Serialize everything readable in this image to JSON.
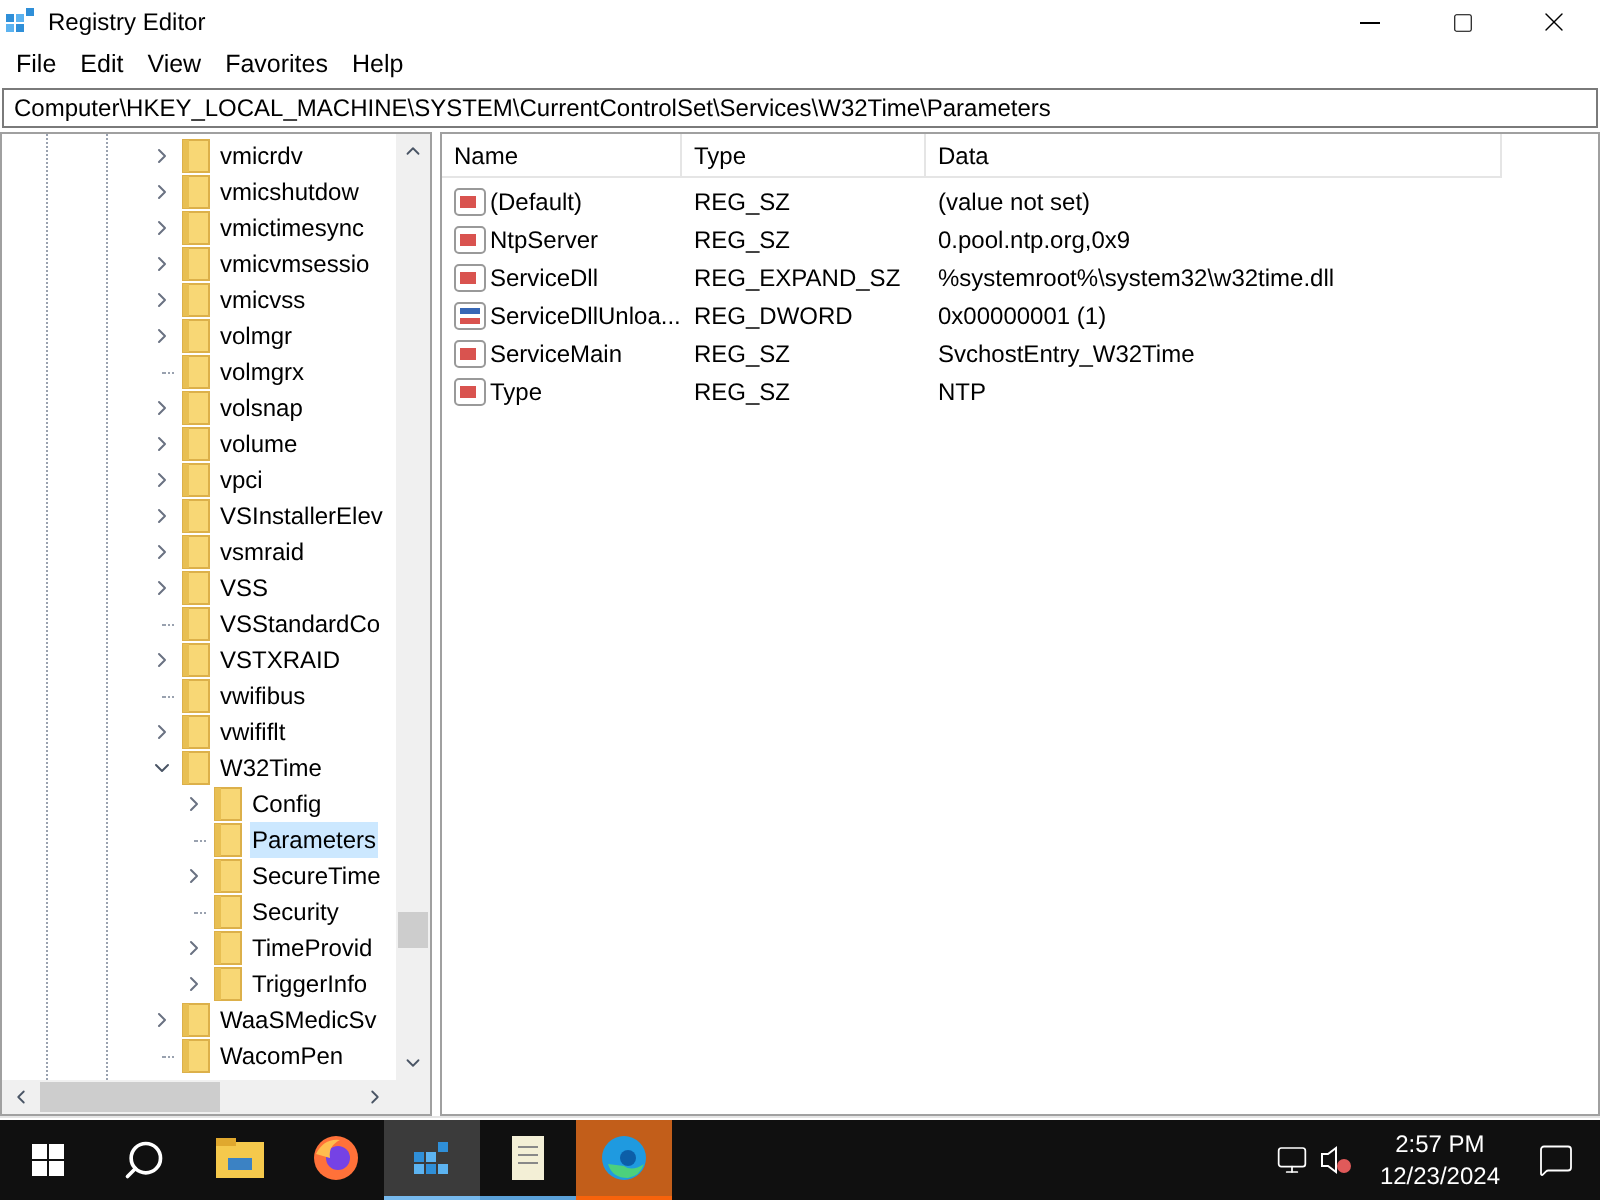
{
  "window": {
    "title": "Registry Editor"
  },
  "menu": [
    "File",
    "Edit",
    "View",
    "Favorites",
    "Help"
  ],
  "address": "Computer\\HKEY_LOCAL_MACHINE\\SYSTEM\\CurrentControlSet\\Services\\W32Time\\Parameters",
  "tree": [
    {
      "label": "vmicrdv",
      "kind": "collapsed",
      "selected": false
    },
    {
      "label": "vmicshutdow",
      "kind": "collapsed",
      "selected": false
    },
    {
      "label": "vmictimesync",
      "kind": "collapsed",
      "selected": false
    },
    {
      "label": "vmicvmsessio",
      "kind": "collapsed",
      "selected": false
    },
    {
      "label": "vmicvss",
      "kind": "collapsed",
      "selected": false
    },
    {
      "label": "volmgr",
      "kind": "collapsed",
      "selected": false
    },
    {
      "label": "volmgrx",
      "kind": "leaf",
      "selected": false
    },
    {
      "label": "volsnap",
      "kind": "collapsed",
      "selected": false
    },
    {
      "label": "volume",
      "kind": "collapsed",
      "selected": false
    },
    {
      "label": "vpci",
      "kind": "collapsed",
      "selected": false
    },
    {
      "label": "VSInstallerElev",
      "kind": "collapsed",
      "selected": false
    },
    {
      "label": "vsmraid",
      "kind": "collapsed",
      "selected": false
    },
    {
      "label": "VSS",
      "kind": "collapsed",
      "selected": false
    },
    {
      "label": "VSStandardCo",
      "kind": "leaf",
      "selected": false
    },
    {
      "label": "VSTXRAID",
      "kind": "collapsed",
      "selected": false
    },
    {
      "label": "vwifibus",
      "kind": "leaf",
      "selected": false
    },
    {
      "label": "vwififlt",
      "kind": "collapsed",
      "selected": false
    },
    {
      "label": "W32Time",
      "kind": "expanded",
      "selected": false,
      "children": [
        {
          "label": "Config",
          "kind": "collapsed",
          "selected": false
        },
        {
          "label": "Parameters",
          "kind": "leaf",
          "selected": true
        },
        {
          "label": "SecureTime",
          "kind": "collapsed",
          "selected": false
        },
        {
          "label": "Security",
          "kind": "leaf",
          "selected": false
        },
        {
          "label": "TimeProvid",
          "kind": "collapsed",
          "selected": false
        },
        {
          "label": "TriggerInfo",
          "kind": "collapsed",
          "selected": false
        }
      ]
    },
    {
      "label": "WaaSMedicSv",
      "kind": "collapsed",
      "selected": false
    },
    {
      "label": "WacomPen",
      "kind": "leaf",
      "selected": false
    }
  ],
  "values": {
    "columns": [
      "Name",
      "Type",
      "Data"
    ],
    "rows": [
      {
        "kind": "string",
        "name": "(Default)",
        "type": "REG_SZ",
        "data": "(value not set)"
      },
      {
        "kind": "string",
        "name": "NtpServer",
        "type": "REG_SZ",
        "data": "0.pool.ntp.org,0x9"
      },
      {
        "kind": "string",
        "name": "ServiceDll",
        "type": "REG_EXPAND_SZ",
        "data": "%systemroot%\\system32\\w32time.dll"
      },
      {
        "kind": "binary",
        "name": "ServiceDllUnloa...",
        "type": "REG_DWORD",
        "data": "0x00000001 (1)"
      },
      {
        "kind": "string",
        "name": "ServiceMain",
        "type": "REG_SZ",
        "data": "SvchostEntry_W32Time"
      },
      {
        "kind": "string",
        "name": "Type",
        "type": "REG_SZ",
        "data": "NTP"
      }
    ]
  },
  "taskbar": {
    "apps": [
      {
        "kind": "explorer",
        "selected": false,
        "running": false,
        "flashing": false
      },
      {
        "kind": "firefox",
        "selected": false,
        "running": false,
        "flashing": false
      },
      {
        "kind": "regedit",
        "selected": true,
        "running": true,
        "flashing": false
      },
      {
        "kind": "notepad",
        "selected": false,
        "running": true,
        "flashing": false
      },
      {
        "kind": "edge",
        "selected": false,
        "running": true,
        "flashing": true
      }
    ],
    "time": "2:57 PM",
    "date": "12/23/2024"
  }
}
